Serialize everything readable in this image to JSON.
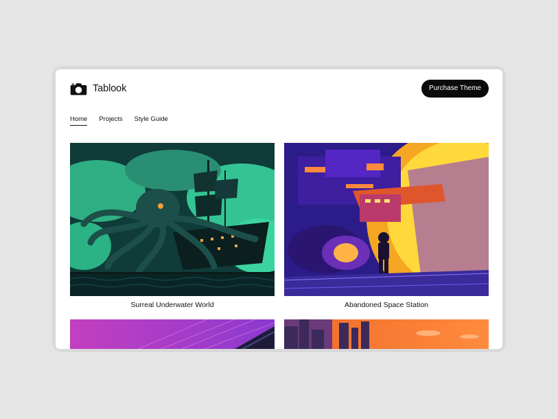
{
  "brand": {
    "name": "Tablook",
    "logo_icon": "camera-icon"
  },
  "header": {
    "cta_label": "Purchase Theme"
  },
  "nav": {
    "items": [
      {
        "label": "Home",
        "active": true
      },
      {
        "label": "Projects",
        "active": false
      },
      {
        "label": "Style Guide",
        "active": false
      }
    ]
  },
  "gallery": {
    "items": [
      {
        "title": "Surreal Underwater World"
      },
      {
        "title": "Abandoned Space Station"
      },
      {
        "title": ""
      },
      {
        "title": ""
      }
    ]
  },
  "colors": {
    "page_background": "#e5e5e5",
    "card_background": "#ffffff",
    "button_background": "#0b0b0b",
    "button_text": "#ffffff"
  }
}
